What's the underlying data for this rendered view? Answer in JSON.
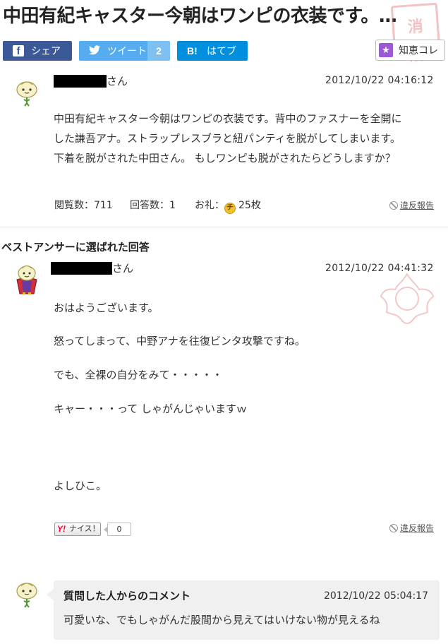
{
  "page": {
    "title": "中田有紀キャスター今朝はワンピの衣装です。…",
    "stamp_text": "消解",
    "share": {
      "facebook_label": "シェア",
      "tweet_label": "ツイート",
      "tweet_count": "2",
      "hatena_label": "はてブ",
      "hatena_icon_text": "B!",
      "chie_label": "知恵コレ"
    }
  },
  "question": {
    "user_suffix": "さん",
    "date": "2012/10/22  04:16:12",
    "body": [
      "中田有紀キャスター今朝はワンピの衣装です。背中のファスナーを全開に",
      "した謙吾アナ。ストラップレスブラと紐パンティを脱がしてしまいます。",
      "下着を脱がされた中田さん。 もしワンピも脱がされたらどうしますか？"
    ],
    "views": "閲覧数：711",
    "answers": "回答数：1",
    "reward_label": "お礼：",
    "reward_coin": "チ",
    "reward_value": "25枚",
    "report": "違反報告"
  },
  "best_answer": {
    "heading": "ベストアンサーに選ばれた回答",
    "user_suffix": "さん",
    "date": "2012/10/22  04:41:32",
    "lines": [
      "おはようございます。",
      "怒ってしまって、中野アナを往復ビンタ攻撃ですね。",
      "でも、全裸の自分をみて・・・・・",
      "キャー・・・って しゃがんじゃいますｗ",
      "よしひこ。"
    ],
    "nice_y": "Y!",
    "nice_label": "ナイス！",
    "nice_count": "0",
    "report": "違反報告"
  },
  "asker_comment": {
    "title": "質問した人からのコメント",
    "date": "2012/10/22 05:04:17",
    "text": "可愛いな、でもしゃがんだ股間から見えてはいけない物が見えるね"
  },
  "colors": {
    "facebook": "#3b5998",
    "twitter": "#55acee",
    "hatena": "#008fde",
    "chie_star": "#9b59d6",
    "stamp": "#dc5050"
  }
}
